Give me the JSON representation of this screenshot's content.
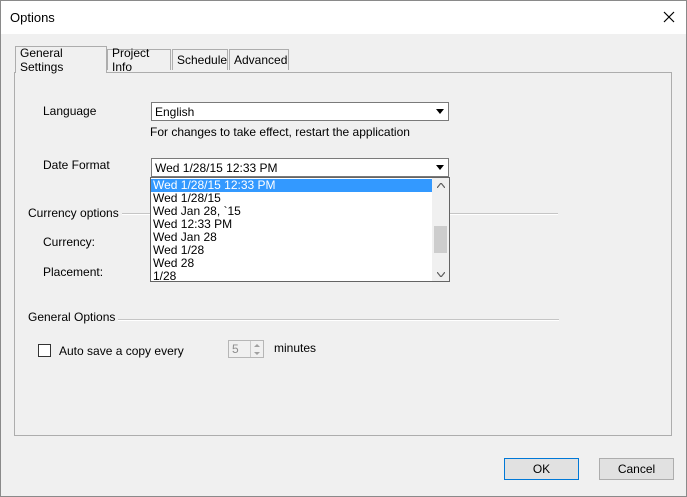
{
  "window": {
    "title": "Options"
  },
  "tabs": [
    {
      "label": "General Settings",
      "active": true
    },
    {
      "label": "Project Info",
      "active": false
    },
    {
      "label": "Schedule",
      "active": false
    },
    {
      "label": "Advanced",
      "active": false
    }
  ],
  "language": {
    "label": "Language",
    "value": "English",
    "hint": "For changes to take effect, restart the application"
  },
  "date_format": {
    "label": "Date Format",
    "value": "Wed 1/28/15 12:33 PM",
    "options": [
      "Wed 1/28/15 12:33 PM",
      "Wed 1/28/15",
      "Wed Jan 28, `15",
      "Wed 12:33 PM",
      "Wed Jan 28",
      "Wed 1/28",
      "Wed 28",
      "1/28"
    ],
    "selected_index": 0
  },
  "currency_options": {
    "title": "Currency options",
    "currency_label": "Currency:",
    "placement_label": "Placement:"
  },
  "general_options": {
    "title": "General Options",
    "autosave_label": "Auto save a copy every",
    "autosave_checked": false,
    "autosave_value": "5",
    "minutes_label": "minutes"
  },
  "buttons": {
    "ok": "OK",
    "cancel": "Cancel"
  },
  "colors": {
    "selection": "#3399ff",
    "default_button_border": "#0078d7"
  }
}
